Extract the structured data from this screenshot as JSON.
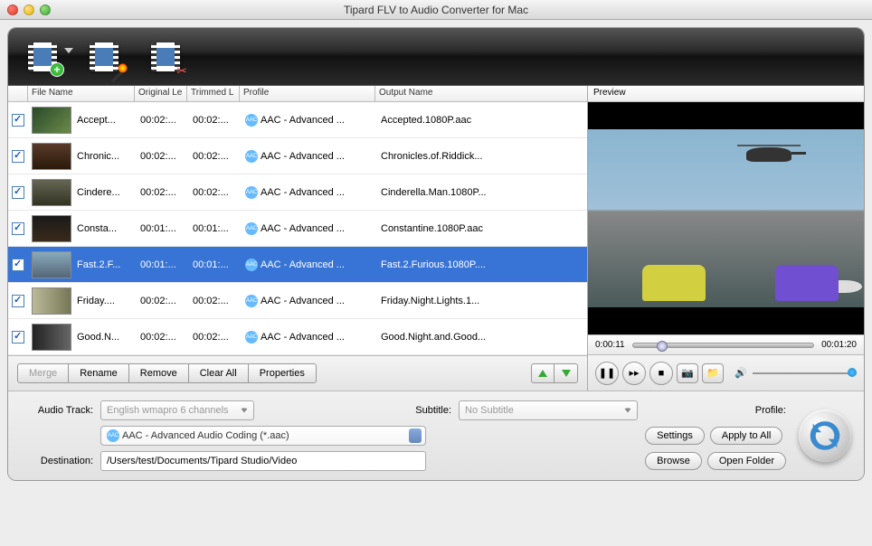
{
  "window": {
    "title": "Tipard FLV to Audio Converter for Mac"
  },
  "columns": {
    "filename": "File Name",
    "original": "Original Le",
    "trimmed": "Trimmed L",
    "profile": "Profile",
    "output": "Output Name"
  },
  "preview": {
    "label": "Preview",
    "current": "0:00:11",
    "total": "00:01:20"
  },
  "rows": [
    {
      "name": "Accept...",
      "orig": "00:02:...",
      "trim": "00:02:...",
      "profile": "AAC - Advanced ...",
      "output": "Accepted.1080P.aac",
      "thumb": "t1",
      "selected": false
    },
    {
      "name": "Chronic...",
      "orig": "00:02:...",
      "trim": "00:02:...",
      "profile": "AAC - Advanced ...",
      "output": "Chronicles.of.Riddick...",
      "thumb": "t2",
      "selected": false
    },
    {
      "name": "Cindere...",
      "orig": "00:02:...",
      "trim": "00:02:...",
      "profile": "AAC - Advanced ...",
      "output": "Cinderella.Man.1080P...",
      "thumb": "t3",
      "selected": false
    },
    {
      "name": "Consta...",
      "orig": "00:01:...",
      "trim": "00:01:...",
      "profile": "AAC - Advanced ...",
      "output": "Constantine.1080P.aac",
      "thumb": "t4",
      "selected": false
    },
    {
      "name": "Fast.2.F...",
      "orig": "00:01:...",
      "trim": "00:01:...",
      "profile": "AAC - Advanced ...",
      "output": "Fast.2.Furious.1080P....",
      "thumb": "t5",
      "selected": true
    },
    {
      "name": "Friday....",
      "orig": "00:02:...",
      "trim": "00:02:...",
      "profile": "AAC - Advanced ...",
      "output": "Friday.Night.Lights.1...",
      "thumb": "t6",
      "selected": false
    },
    {
      "name": "Good.N...",
      "orig": "00:02:...",
      "trim": "00:02:...",
      "profile": "AAC - Advanced ...",
      "output": "Good.Night.and.Good...",
      "thumb": "t7",
      "selected": false
    }
  ],
  "list_buttons": {
    "merge": "Merge",
    "rename": "Rename",
    "remove": "Remove",
    "clear": "Clear All",
    "properties": "Properties"
  },
  "labels": {
    "audio_track": "Audio Track:",
    "subtitle": "Subtitle:",
    "profile": "Profile:",
    "destination": "Destination:"
  },
  "values": {
    "audio_track": "English wmapro 6 channels",
    "subtitle": "No Subtitle",
    "profile": "AAC - Advanced Audio Coding (*.aac)",
    "destination": "/Users/test/Documents/Tipard Studio/Video"
  },
  "action_buttons": {
    "settings": "Settings",
    "apply": "Apply to All",
    "browse": "Browse",
    "open": "Open Folder"
  },
  "aac_badge": "AAC"
}
